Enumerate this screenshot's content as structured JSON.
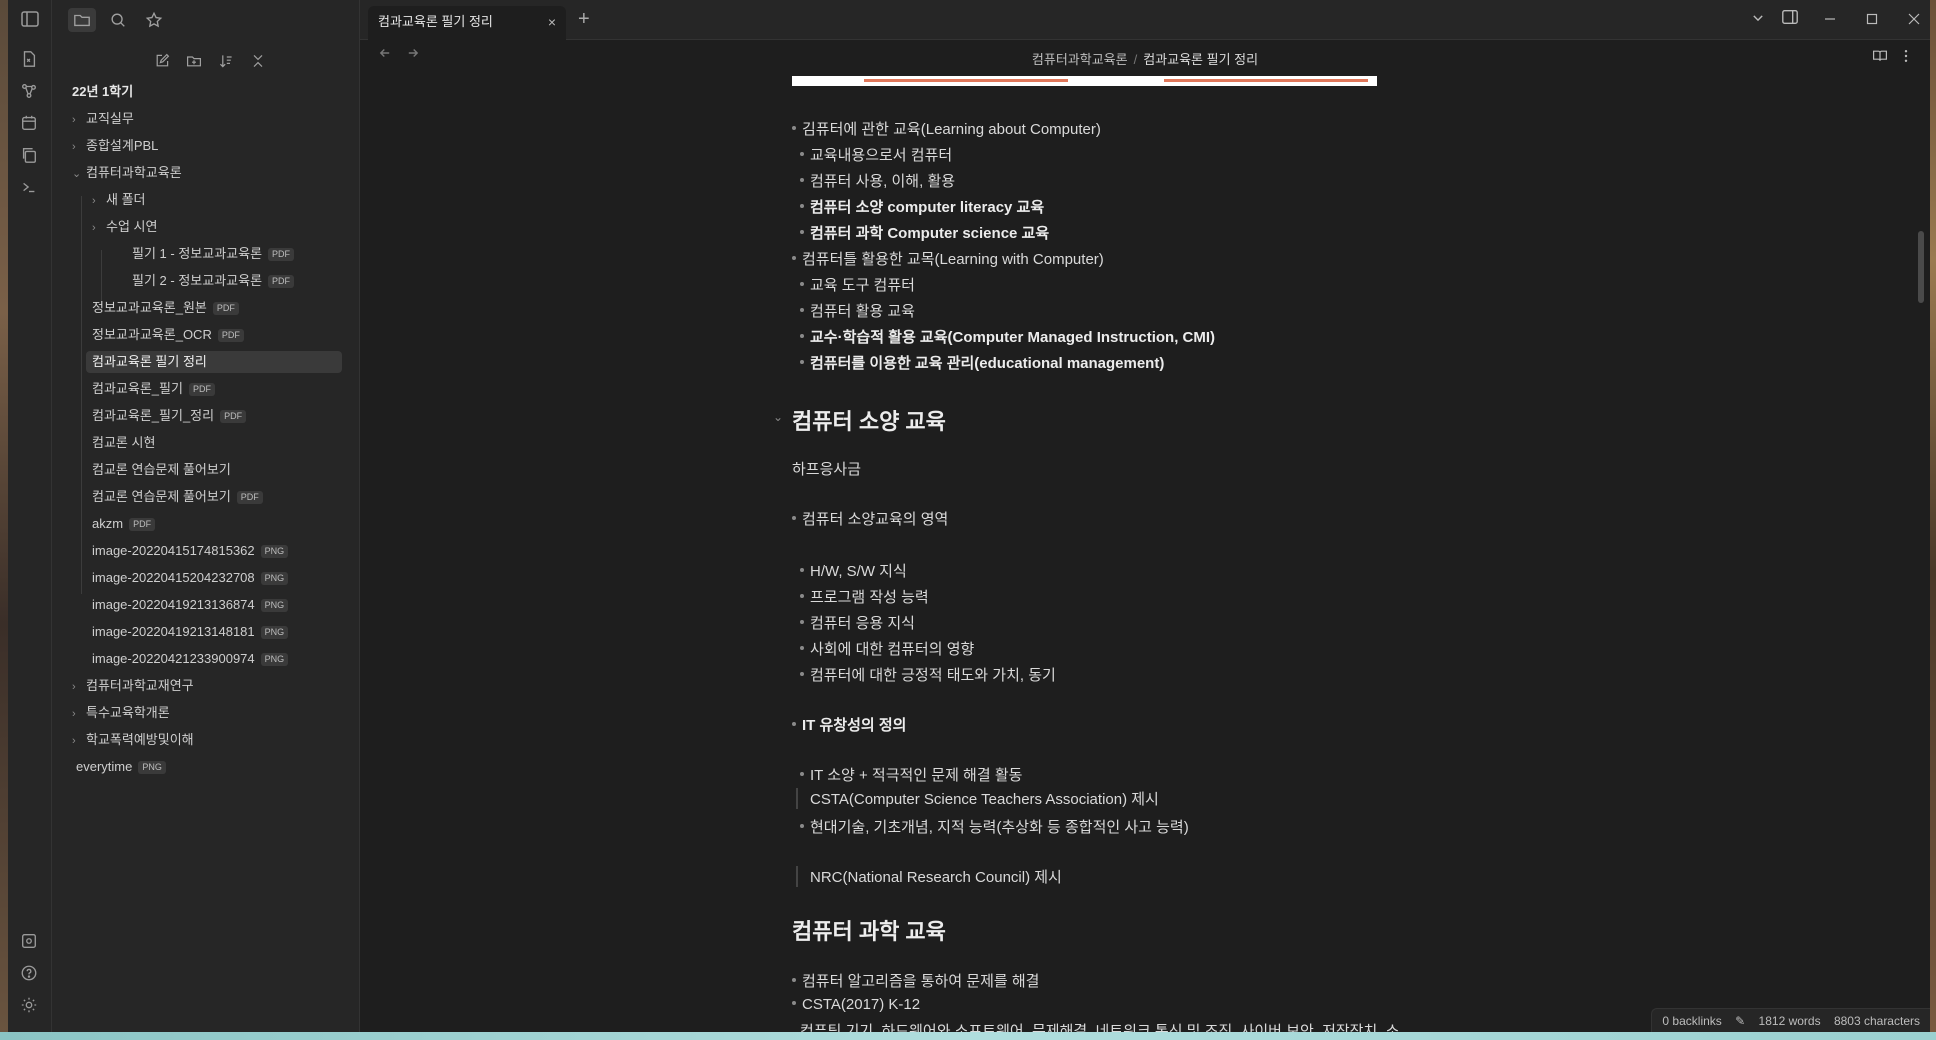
{
  "tab": {
    "title": "컴과교육론 필기 정리",
    "close": "×",
    "new": "+"
  },
  "breadcrumb": {
    "parent": "컴퓨터과학교육론",
    "sep": "/",
    "current": "컴과교육론 필기 정리"
  },
  "tree": {
    "root": "22년 1학기",
    "items": [
      {
        "label": "교직실무",
        "chev": "›"
      },
      {
        "label": "종합설계PBL",
        "chev": "›"
      },
      {
        "label": "컴퓨터과학교육론",
        "chev": "⌄"
      },
      {
        "label": "새 폴더",
        "chev": "›"
      },
      {
        "label": "수업 시연",
        "chev": "›"
      },
      {
        "label": "필기 1 - 정보교과교육론",
        "badge": "PDF"
      },
      {
        "label": "필기 2 - 정보교과교육론",
        "badge": "PDF"
      },
      {
        "label": "정보교과교육론_원본",
        "badge": "PDF"
      },
      {
        "label": "정보교과교육론_OCR",
        "badge": "PDF"
      },
      {
        "label": "컴과교육론 필기 정리"
      },
      {
        "label": "컴과교육론_필기",
        "badge": "PDF"
      },
      {
        "label": "컴과교육론_필기_정리",
        "badge": "PDF"
      },
      {
        "label": "컴교론 시현"
      },
      {
        "label": "컴교론 연습문제 풀어보기"
      },
      {
        "label": "컴교론 연습문제 풀어보기",
        "badge": "PDF"
      },
      {
        "label": "akzm",
        "badge": "PDF"
      },
      {
        "label": "image-20220415174815362",
        "badge": "PNG"
      },
      {
        "label": "image-20220415204232708",
        "badge": "PNG"
      },
      {
        "label": "image-20220419213136874",
        "badge": "PNG"
      },
      {
        "label": "image-20220419213148181",
        "badge": "PNG"
      },
      {
        "label": "image-20220421233900974",
        "badge": "PNG"
      },
      {
        "label": "컴퓨터과학교재연구",
        "chev": "›"
      },
      {
        "label": "특수교육학개론",
        "chev": "›"
      },
      {
        "label": "학교폭력예방및이해",
        "chev": "›"
      },
      {
        "label": "everytime",
        "badge": "PNG"
      }
    ]
  },
  "doc": {
    "l1": "김퓨터에 관한 교육(Learning about Computer)",
    "l2": "교육내용으로서 컴퓨터",
    "l3": "컴퓨터 사용, 이해, 활용",
    "l4": "컴퓨터 소양 computer literacy 교육",
    "l5": "컴퓨터 과학 Computer science 교육",
    "l6": "컴퓨터틀 활용한 교목(Learning with Computer)",
    "l7": "교육 도구 컴퓨터",
    "l8": "컴퓨터 활용 교육",
    "l9": "교수·학습적 활용 교육(Computer Managed Instruction, CMI)",
    "l10": "컴퓨터를 이용한 교육 관리(educational management)",
    "h1": "컴퓨터 소양 교육",
    "p1": "하프응사금",
    "l11": "컴퓨터 소양교육의 영역",
    "l12": "H/W, S/W 지식",
    "l13": "프로그램 작성 능력",
    "l14": "컴퓨터 응용 지식",
    "l15": "사회에 대한 컴퓨터의 영향",
    "l16": "컴퓨터에 대한 긍정적 태도와 가치,  동기",
    "l17": "IT 유창성의 정의",
    "l18": "IT 소양 + 적극적인 문제 해결 활동",
    "q1": "CSTA(Computer Science Teachers Association) 제시",
    "l19": "현대기술, 기초개념, 지적 능력(추상화 등 종합적인 사고 능력)",
    "q2": "NRC(National Research Council) 제시",
    "h2": "컴퓨터 과학 교육",
    "l20": "컴퓨터 알고리즘을 통하여 문제를 해결",
    "l21": "CSTA(2017) K-12",
    "l22": "컴퓨팅 기기, 하드웨어와 소프트웨어, 문제해결, 네트워크 통신 및 조직, 사이버 보안, 저장장치, 소"
  },
  "status": {
    "backlinks": "0 backlinks",
    "words": "1812 words",
    "chars": "8803 characters"
  }
}
